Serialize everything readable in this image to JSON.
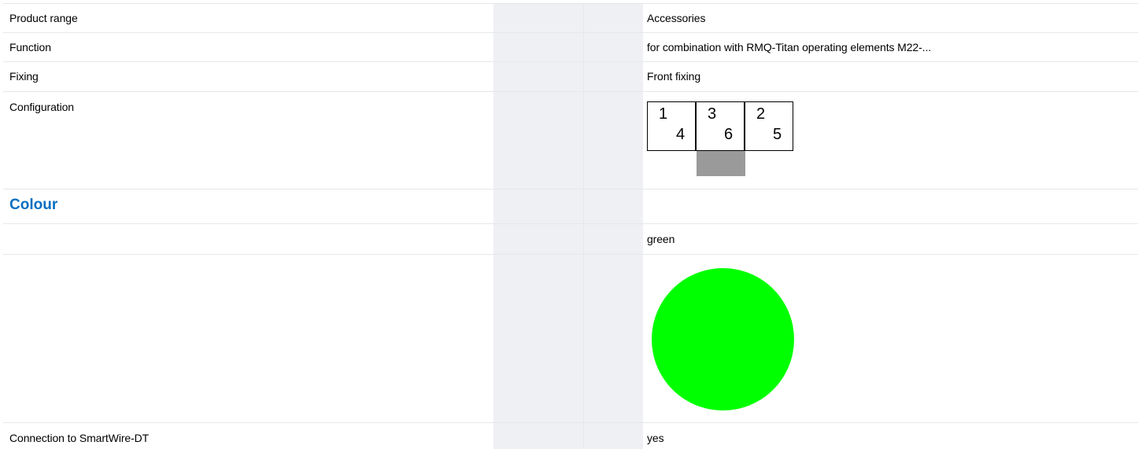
{
  "rows": [
    {
      "label": "Product range",
      "value": "Accessories"
    },
    {
      "label": "Function",
      "value": "for combination with RMQ-Titan operating elements M22-..."
    },
    {
      "label": "Fixing",
      "value": "Front fixing"
    },
    {
      "label": "Configuration",
      "value": ""
    }
  ],
  "configuration": {
    "cells": [
      {
        "top": "1",
        "bottom": "4"
      },
      {
        "top": "3",
        "bottom": "6"
      },
      {
        "top": "2",
        "bottom": "5"
      }
    ],
    "actuator_color": "#9a9a9a"
  },
  "colour_section": {
    "title": "Colour",
    "title_color": "#0a6fc2",
    "colour_name": "green",
    "swatch_color": "#00ff00"
  },
  "smartwire": {
    "label": "Connection to SmartWire-DT",
    "value": "yes"
  }
}
